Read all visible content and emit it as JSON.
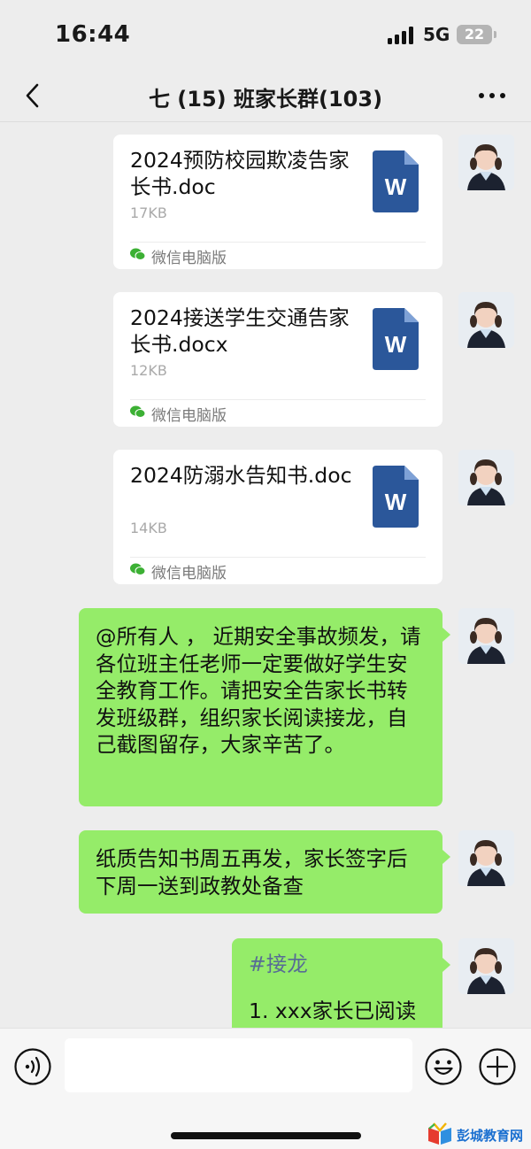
{
  "status_bar": {
    "time": "16:44",
    "network": "5G",
    "battery": "22"
  },
  "nav": {
    "title": "七 (15) 班家长群(103)",
    "back_icon": "chevron-left-icon",
    "more_icon": "more-dots-icon"
  },
  "messages": [
    {
      "type": "file",
      "name": "2024预防校园欺凌告家长书.doc",
      "size": "17KB",
      "source": "微信电脑版",
      "file_icon": "word-doc-icon",
      "file_icon_letter": "W"
    },
    {
      "type": "file",
      "name": "2024接送学生交通告家长书.docx",
      "size": "12KB",
      "source": "微信电脑版",
      "file_icon": "word-doc-icon",
      "file_icon_letter": "W"
    },
    {
      "type": "file",
      "name": "2024防溺水告知书.doc",
      "size": "14KB",
      "source": "微信电脑版",
      "file_icon": "word-doc-icon",
      "file_icon_letter": "W"
    },
    {
      "type": "text",
      "text": "@所有人 ， 近期安全事故频发，请各位班主任老师一定要做好学生安全教育工作。请把安全告家长书转发班级群，组织家长阅读接龙，自己截图留存，大家辛苦了。"
    },
    {
      "type": "text",
      "text": "纸质告知书周五再发，家长签字后下周一送到政教处备查"
    },
    {
      "type": "solitaire",
      "hashtag": "#接龙",
      "line1": "1. xxx家长已阅读"
    }
  ],
  "input_bar": {
    "voice_icon": "voice-icon",
    "emoji_icon": "emoji-icon",
    "plus_icon": "plus-icon",
    "input_value": ""
  },
  "watermark": {
    "text": "彭城教育网"
  },
  "colors": {
    "background": "#ededed",
    "bubble_green": "#95ec69",
    "word_blue": "#2b579a",
    "hashtag_blue": "#576b95"
  }
}
